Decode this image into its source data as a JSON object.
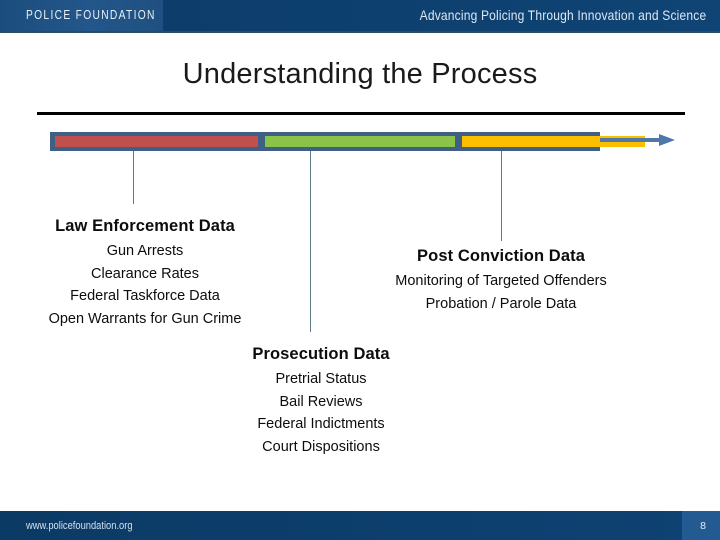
{
  "header": {
    "logo_text": "POLICE FOUNDATION",
    "tagline": "Advancing Policing Through  Innovation and Science",
    "bg_color": "#0d3f6e",
    "logo_box_color": "#23568a"
  },
  "slide": {
    "title": "Understanding the Process"
  },
  "process_bar": {
    "frame_color": "#3f5f85",
    "segments": [
      {
        "name": "law-enforcement-stage",
        "color": "#c0504d"
      },
      {
        "name": "prosecution-stage",
        "color": "#8ac34a"
      },
      {
        "name": "post-conviction-stage",
        "color": "#fbbf00"
      }
    ],
    "arrow_color": "#4e78a8"
  },
  "blocks": [
    {
      "heading": "Law Enforcement Data",
      "items": [
        "Gun Arrests",
        "Clearance Rates",
        "Federal Taskforce Data",
        "Open Warrants for Gun Crime"
      ]
    },
    {
      "heading": "Post Conviction Data",
      "items": [
        "Monitoring of Targeted Offenders",
        "Probation / Parole Data"
      ]
    },
    {
      "heading": "Prosecution Data",
      "items": [
        "Pretrial Status",
        "Bail Reviews",
        "Federal Indictments",
        "Court Dispositions"
      ]
    }
  ],
  "footer": {
    "url": "www.policefoundation.org",
    "page_number": "8",
    "bg_color": "#0d3f6e",
    "page_box_color": "#245a92"
  }
}
